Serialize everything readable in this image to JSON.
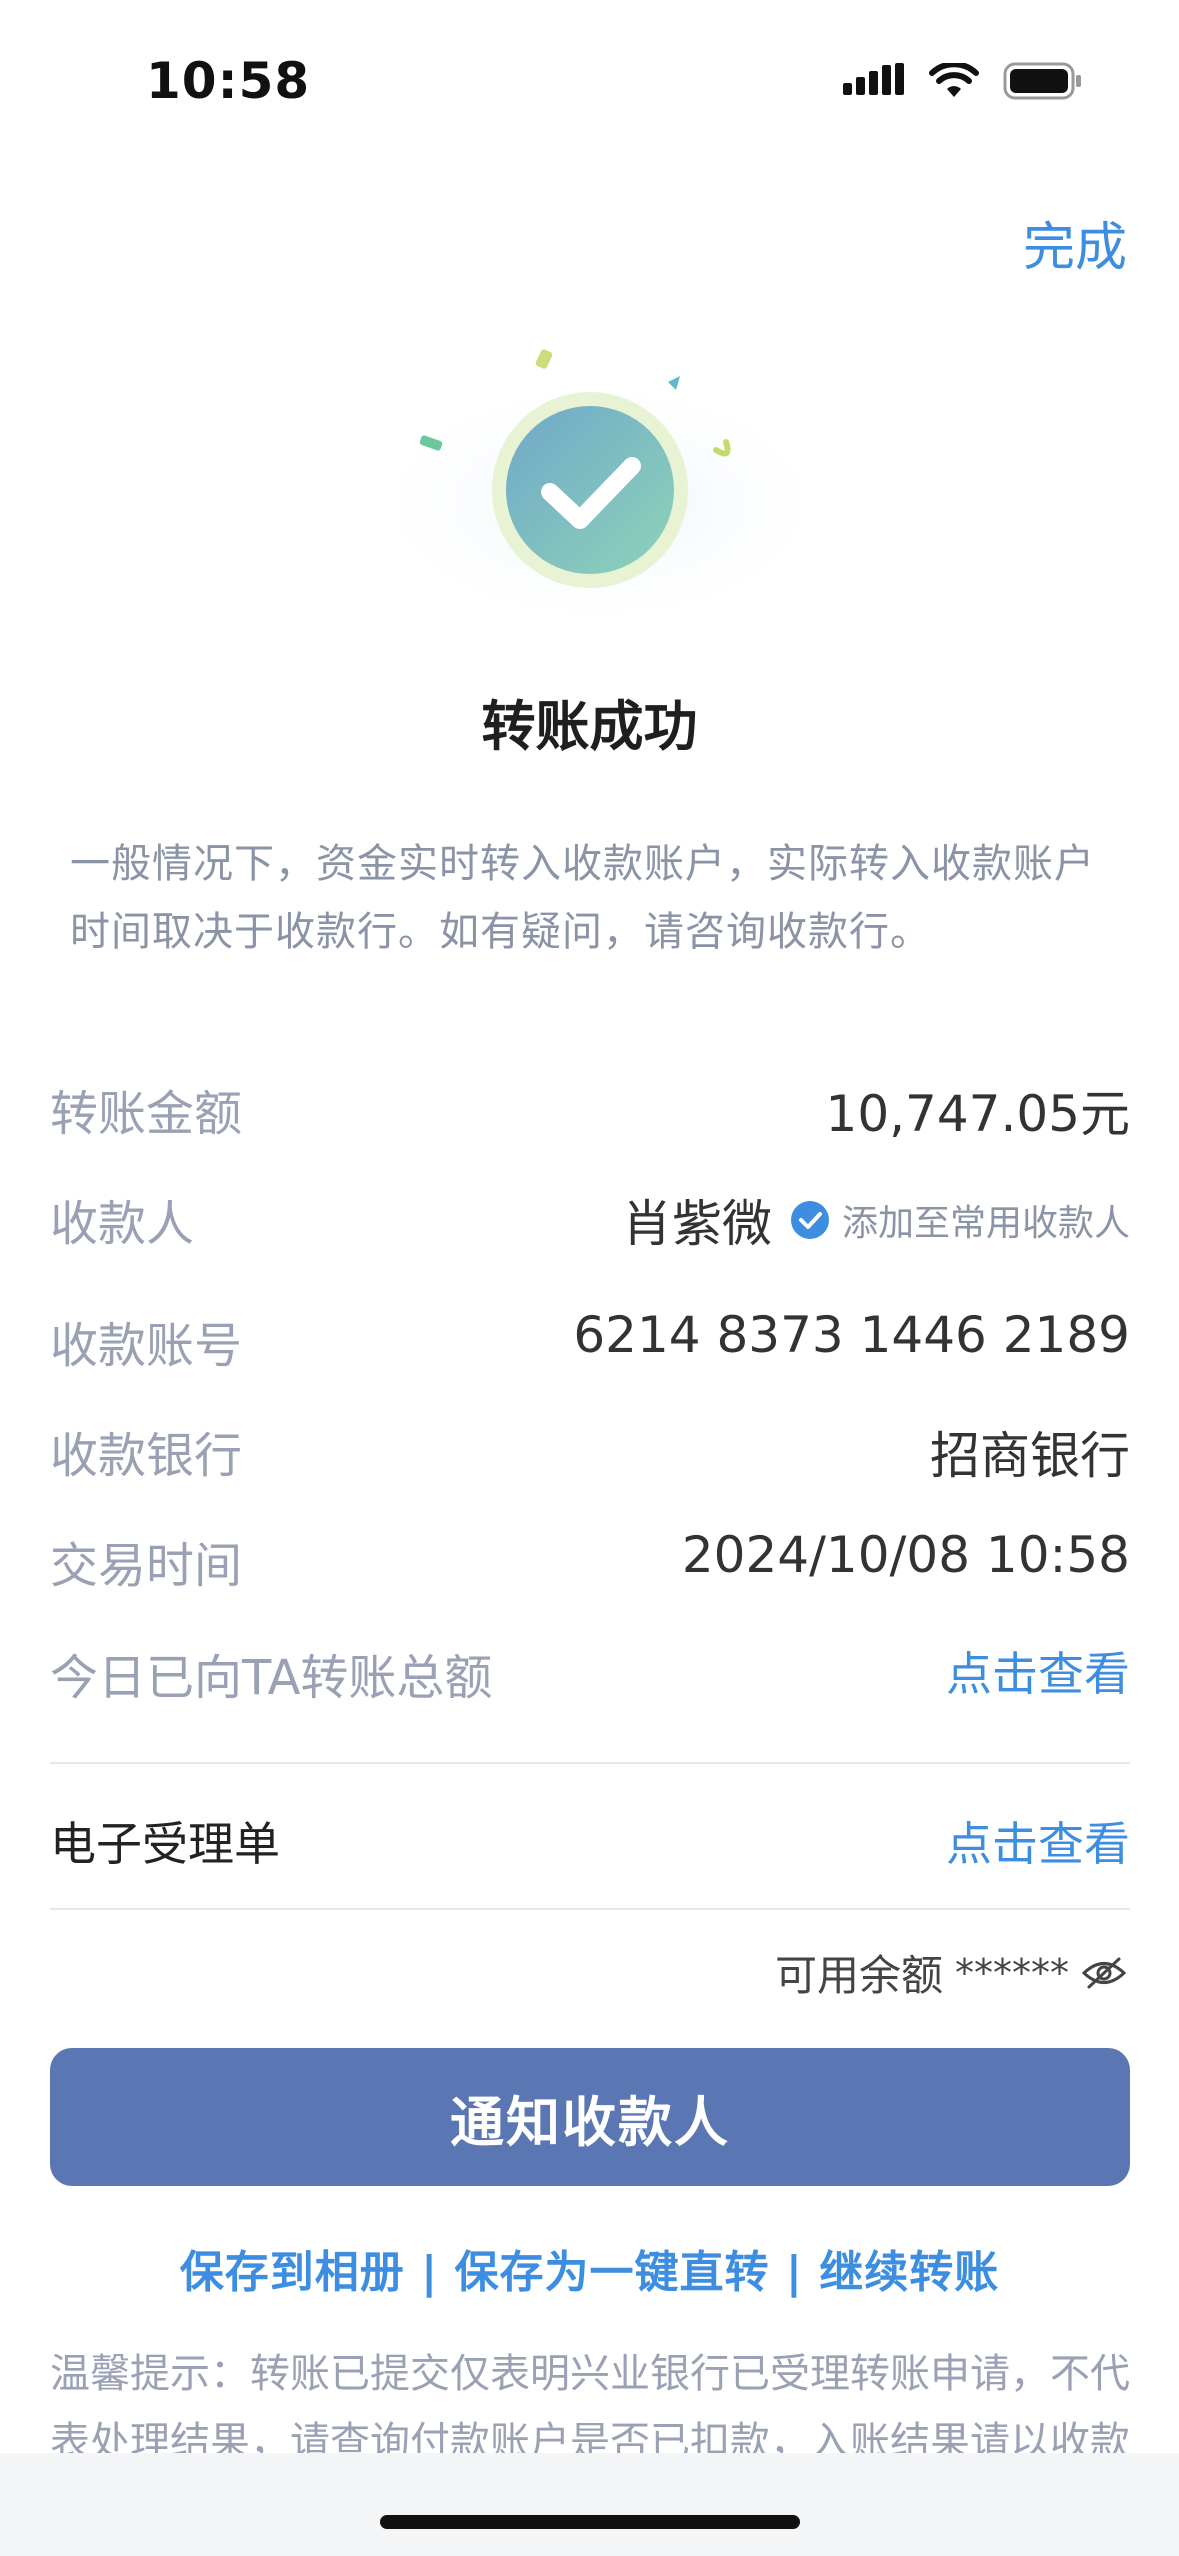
{
  "status_bar": {
    "time": "10:58",
    "icons": [
      "signal-icon",
      "wifi-icon",
      "battery-icon"
    ]
  },
  "header": {
    "done_label": "完成"
  },
  "result": {
    "title": "转账成功",
    "notice": "一般情况下，资金实时转入收款账户，实际转入收款账户时间取决于收款行。如有疑问，请咨询收款行。"
  },
  "details": {
    "amount": {
      "label": "转账金额",
      "value": "10,747.05元"
    },
    "payee": {
      "label": "收款人",
      "name": "肖紫微",
      "add_label": "添加至常用收款人"
    },
    "account": {
      "label": "收款账号",
      "value": "6214 8373 1446 2189"
    },
    "bank": {
      "label": "收款银行",
      "value": "招商银行"
    },
    "time": {
      "label": "交易时间",
      "value": "2024/10/08 10:58"
    },
    "today_total": {
      "label": "今日已向TA转账总额",
      "link": "点击查看"
    }
  },
  "receipt": {
    "label": "电子受理单",
    "link": "点击查看"
  },
  "balance": {
    "label": "可用余额",
    "value": "******"
  },
  "primary_button": "通知收款人",
  "actions": {
    "save_album": "保存到相册",
    "separator": " | ",
    "save_quick": "保存为一键直转",
    "continue": "继续转账"
  },
  "tip": "温馨提示：转账已提交仅表明兴业银行已受理转账申请，不代表处理结果，请查询付款账户是否已扣款，入账结果请以收款",
  "colors": {
    "accent": "#3d8de0",
    "button": "#5b77b3",
    "label_gray": "#9aa1b4"
  }
}
